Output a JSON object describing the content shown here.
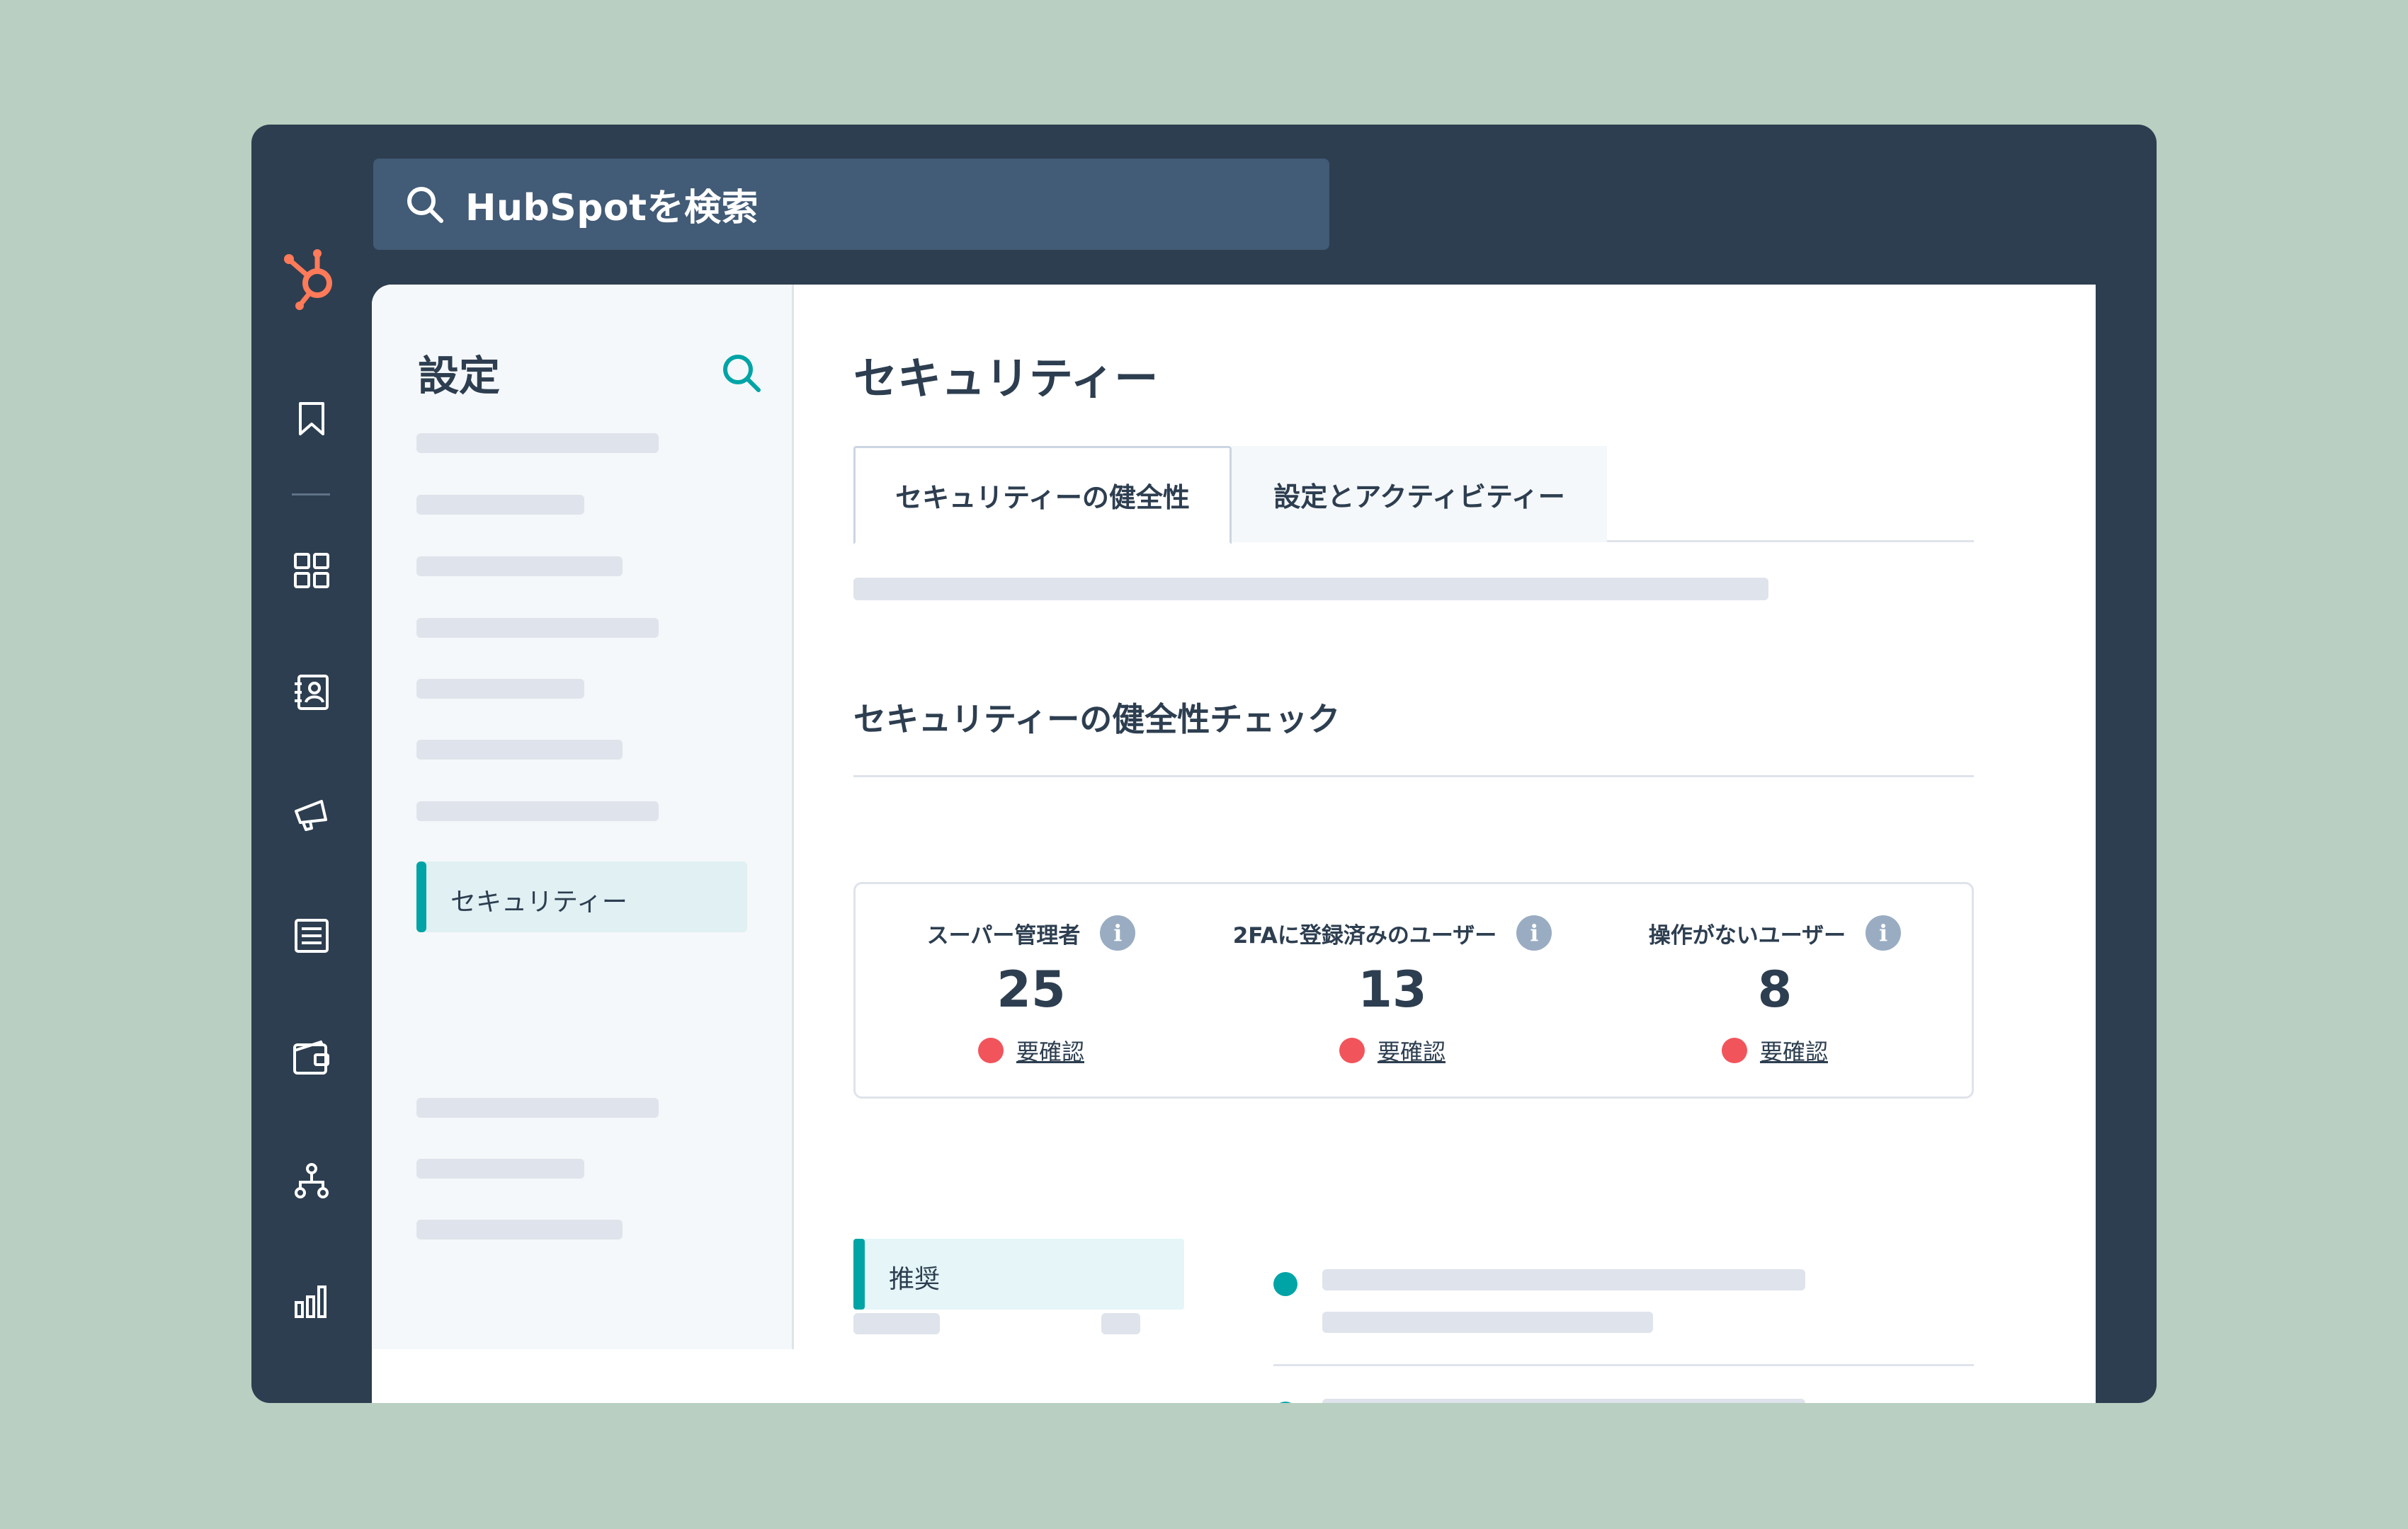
{
  "colors": {
    "background": "#b8cfc1",
    "frame": "#2d3e50",
    "search_bar": "#425b76",
    "accent_teal": "#00a4a6",
    "brand_orange": "#ff7a59",
    "alert_red": "#f2545b"
  },
  "global_search": {
    "icon": "search-icon",
    "text": "HubSpotを検索"
  },
  "nav_rail": {
    "logo": "hubspot-sprocket-logo",
    "icons": [
      "bookmark-icon",
      "grid-icon",
      "contacts-icon",
      "megaphone-icon",
      "newsletter-icon",
      "wallet-icon",
      "hierarchy-icon",
      "bar-chart-icon"
    ]
  },
  "sidebar": {
    "title": "設定",
    "search_icon": "search-icon",
    "active_item": "セキュリティー"
  },
  "page": {
    "title": "セキュリティー",
    "tabs": [
      {
        "label": "セキュリティーの健全性",
        "active": true
      },
      {
        "label": "設定とアクティビティー",
        "active": false
      }
    ],
    "section_title": "セキュリティーの健全性チェック"
  },
  "stats": [
    {
      "label": "スーパー管理者",
      "value": "25",
      "status": "要確認"
    },
    {
      "label": "2FAに登録済みのユーザー",
      "value": "13",
      "status": "要確認"
    },
    {
      "label": "操作がないユーザー",
      "value": "8",
      "status": "要確認"
    }
  ],
  "recommendation": {
    "label": "推奨"
  }
}
